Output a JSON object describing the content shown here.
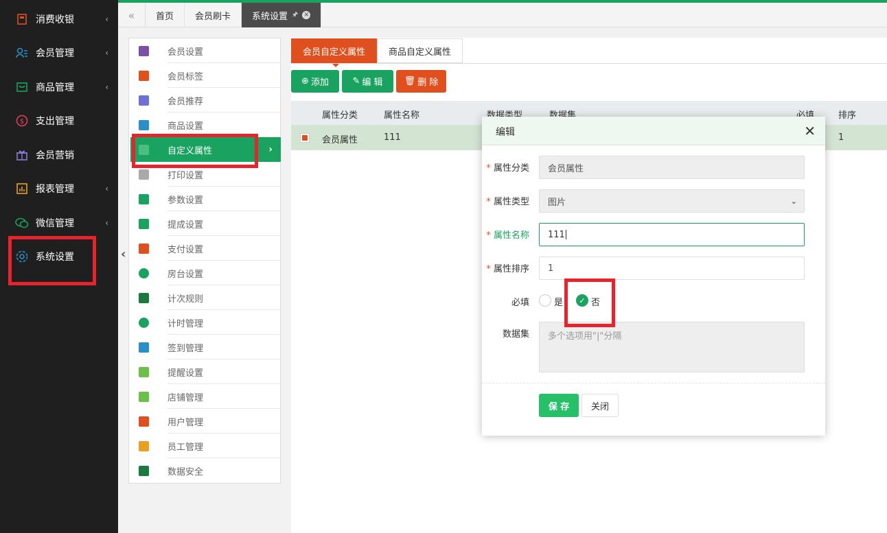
{
  "sidebar": {
    "items": [
      {
        "label": "消费收银",
        "icon": "cashier-icon",
        "chevron": "‹"
      },
      {
        "label": "会员管理",
        "icon": "member-icon",
        "chevron": "‹"
      },
      {
        "label": "商品管理",
        "icon": "goods-icon",
        "chevron": "‹"
      },
      {
        "label": "支出管理",
        "icon": "expense-icon",
        "chevron": ""
      },
      {
        "label": "会员营销",
        "icon": "gift-icon",
        "chevron": ""
      },
      {
        "label": "报表管理",
        "icon": "report-icon",
        "chevron": "‹"
      },
      {
        "label": "微信管理",
        "icon": "wechat-icon",
        "chevron": "‹"
      },
      {
        "label": "系统设置",
        "icon": "gear-icon",
        "chevron": ""
      }
    ]
  },
  "topbar": {
    "collapse_icon": "«",
    "tabs": [
      {
        "label": "首页"
      },
      {
        "label": "会员刷卡"
      },
      {
        "label": "系统设置"
      }
    ]
  },
  "settings_menu": {
    "items": [
      {
        "label": "会员设置",
        "color": "#7b4fa8"
      },
      {
        "label": "会员标签",
        "color": "#e0501f"
      },
      {
        "label": "会员推荐",
        "color": "#6f6fd8"
      },
      {
        "label": "商品设置",
        "color": "#2a8fc8"
      },
      {
        "label": "自定义属性",
        "color": "#ffffff"
      },
      {
        "label": "打印设置",
        "color": "#999999"
      },
      {
        "label": "参数设置",
        "color": "#1aa260"
      },
      {
        "label": "提成设置",
        "color": "#1aa260"
      },
      {
        "label": "支付设置",
        "color": "#e0501f"
      },
      {
        "label": "房台设置",
        "color": "#1aa260"
      },
      {
        "label": "计次规则",
        "color": "#1a7a40"
      },
      {
        "label": "计时管理",
        "color": "#1aa260"
      },
      {
        "label": "签到管理",
        "color": "#2a8fc8"
      },
      {
        "label": "提醒设置",
        "color": "#6cc04a"
      },
      {
        "label": "店铺管理",
        "color": "#6cc04a"
      },
      {
        "label": "用户管理",
        "color": "#e0501f"
      },
      {
        "label": "员工管理",
        "color": "#e8a020"
      },
      {
        "label": "数据安全",
        "color": "#1a7a40"
      }
    ]
  },
  "content": {
    "tabs": [
      "会员自定义属性",
      "商品自定义属性"
    ],
    "buttons": {
      "add": "添加",
      "edit": "编 辑",
      "delete": "删 除"
    },
    "columns": [
      "属性分类",
      "属性名称",
      "数据类型",
      "数据集",
      "必填",
      "排序"
    ],
    "row": {
      "category": "会员属性",
      "name": "111",
      "sort": "1"
    }
  },
  "modal": {
    "title": "编辑",
    "close": "✕",
    "fields": {
      "category_label": "属性分类",
      "category_value": "会员属性",
      "type_label": "属性类型",
      "type_value": "图片",
      "name_label": "属性名称",
      "name_value": "111",
      "sort_label": "属性排序",
      "sort_value": "1",
      "required_label": "必填",
      "required_yes": "是",
      "required_no": "否",
      "dataset_label": "数据集",
      "dataset_placeholder": "多个选项用\"|\"分隔"
    },
    "save": "保 存",
    "cancel": "关闭"
  },
  "accent": "#1aa260",
  "alert": "#e0501f"
}
